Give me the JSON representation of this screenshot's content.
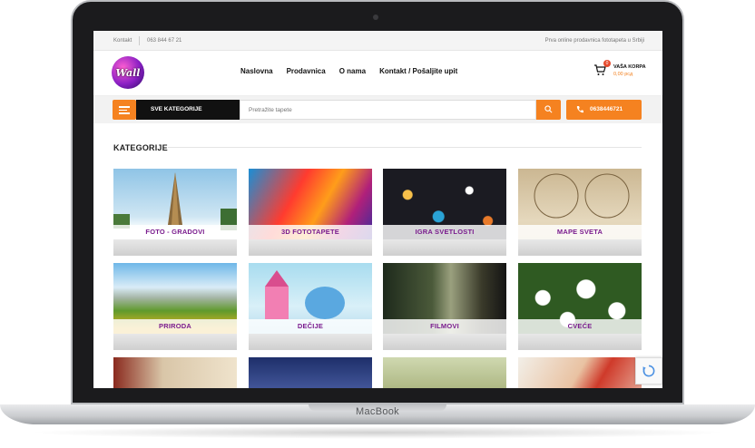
{
  "device": {
    "brand": "MacBook"
  },
  "topbar": {
    "contact": "Kontakt",
    "phone": "063 844 67 21",
    "tagline": "Prva online prodavnica fototapeta u Srbiji"
  },
  "header": {
    "logo_text": "Wall",
    "nav": [
      "Naslovna",
      "Prodavnica",
      "O nama",
      "Kontakt / Pošaljite upit"
    ],
    "cart": {
      "badge": "0",
      "label": "VAŠA KORPA",
      "total": "0,00 рсд"
    }
  },
  "searchbar": {
    "categories_button": "SVE KATEGORIJE",
    "search_placeholder": "Pretražite tapete",
    "phone_button": "0638446721"
  },
  "section": {
    "title": "KATEGORIJE"
  },
  "categories": [
    {
      "label": "FOTO - GRADOVI"
    },
    {
      "label": "3D FOTOTAPETE"
    },
    {
      "label": "IGRA SVETLOSTI"
    },
    {
      "label": "MAPE SVETA"
    },
    {
      "label": "PRIRODA"
    },
    {
      "label": "DEČIJE"
    },
    {
      "label": "FILMOVI"
    },
    {
      "label": "CVEĆE"
    },
    {
      "label": ""
    },
    {
      "label": ""
    },
    {
      "label": ""
    },
    {
      "label": ""
    }
  ],
  "colors": {
    "accent": "#f58220",
    "label_purple": "#7a1c8e",
    "dark": "#111111"
  }
}
